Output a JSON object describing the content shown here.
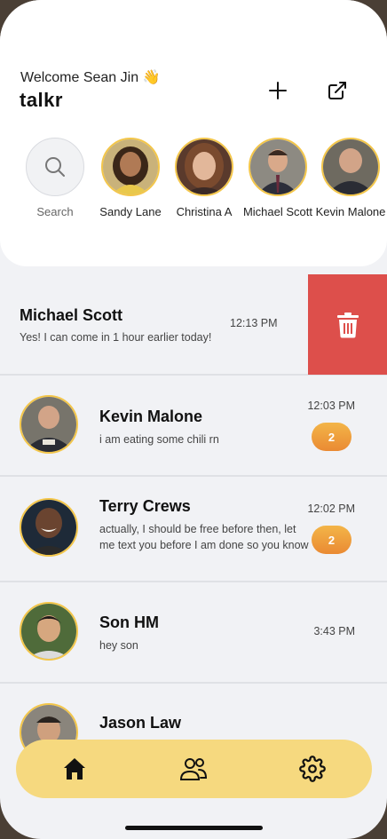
{
  "header": {
    "welcome": "Welcome Sean Jin 👋",
    "brand": "talkr",
    "plus_icon": "plus-icon",
    "share_icon": "external-link-icon"
  },
  "stories": [
    {
      "label": "Search",
      "icon": "search-icon"
    },
    {
      "label": "Sandy Lane"
    },
    {
      "label": "Christina A"
    },
    {
      "label": "Michael Scott"
    },
    {
      "label": "Kevin Malone"
    }
  ],
  "swiped_chat": {
    "name": "Michael Scott",
    "message": "Yes! I can come in 1 hour earlier today!",
    "time": "12:13 PM",
    "delete_icon": "trash-icon",
    "delete_color": "#dd4f4b"
  },
  "chats": [
    {
      "name": "Kevin Malone",
      "message": "i am eating some chili rn",
      "time": "12:03 PM",
      "unread": "2"
    },
    {
      "name": "Terry Crews",
      "message": "actually, I should be free before then, let me text you before I am done so you know",
      "time": "12:02 PM",
      "unread": "2"
    },
    {
      "name": "Son HM",
      "message": "hey son",
      "time": "3:43 PM"
    },
    {
      "name": "Jason Law"
    }
  ],
  "nav": {
    "home_icon": "home-icon",
    "contacts_icon": "users-icon",
    "settings_icon": "gear-icon",
    "bg_color": "#f6d97f"
  },
  "colors": {
    "accent": "#f3c64a",
    "badge": "#ea8a33"
  }
}
